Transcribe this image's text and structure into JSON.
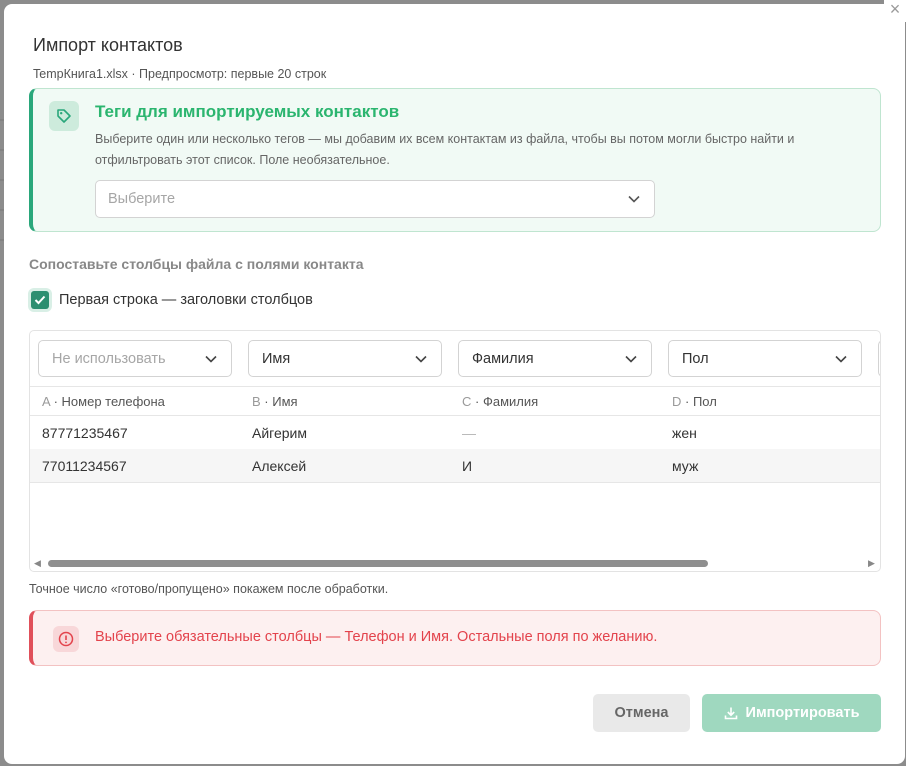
{
  "dialog": {
    "title": "Импорт контактов",
    "subtitle": "TempКнига1.xlsx · Предпросмотр: первые 20 строк",
    "close_glyph": "×"
  },
  "tags": {
    "icon": "tag-icon",
    "title": "Теги для импортируемых контактов",
    "description": "Выберите один или несколько тегов — мы добавим их всем контактам из файла, чтобы вы потом могли быстро найти и отфильтровать этот список. Поле необязательное.",
    "select_placeholder": "Выберите"
  },
  "mapping": {
    "heading": "Сопоставьте столбцы файла с полями контакта",
    "first_row_header_label": "Первая строка — заголовки столбцов",
    "first_row_header_checked": true,
    "selects": [
      {
        "value": "Не использовать",
        "placeholder": true
      },
      {
        "value": "Имя",
        "placeholder": false
      },
      {
        "value": "Фамилия",
        "placeholder": false
      },
      {
        "value": "Пол",
        "placeholder": false
      }
    ],
    "columns": [
      {
        "letter": "A",
        "name": "Номер телефона"
      },
      {
        "letter": "B",
        "name": "Имя"
      },
      {
        "letter": "C",
        "name": "Фамилия"
      },
      {
        "letter": "D",
        "name": "Пол"
      }
    ],
    "rows": [
      [
        "87771235467",
        "Айгерим",
        "—",
        "жен"
      ],
      [
        "77011234567",
        "Алексей",
        "И",
        "муж"
      ]
    ],
    "horizontal_scroll_position": 0
  },
  "note": "Точное число «готово/пропущено» покажем после обработки.",
  "error": {
    "icon": "alert-circle-icon",
    "text": "Выберите обязательные столбцы — Телефон и Имя. Остальные поля по желанию."
  },
  "actions": {
    "cancel_label": "Отмена",
    "import_label": "Импортировать",
    "import_icon": "download-icon",
    "import_disabled": true
  },
  "colors": {
    "accent_green": "#2aa77b",
    "tag_title_green": "#2bb56f",
    "error_red": "#e3434c",
    "import_button_disabled": "#9fd8bf"
  }
}
